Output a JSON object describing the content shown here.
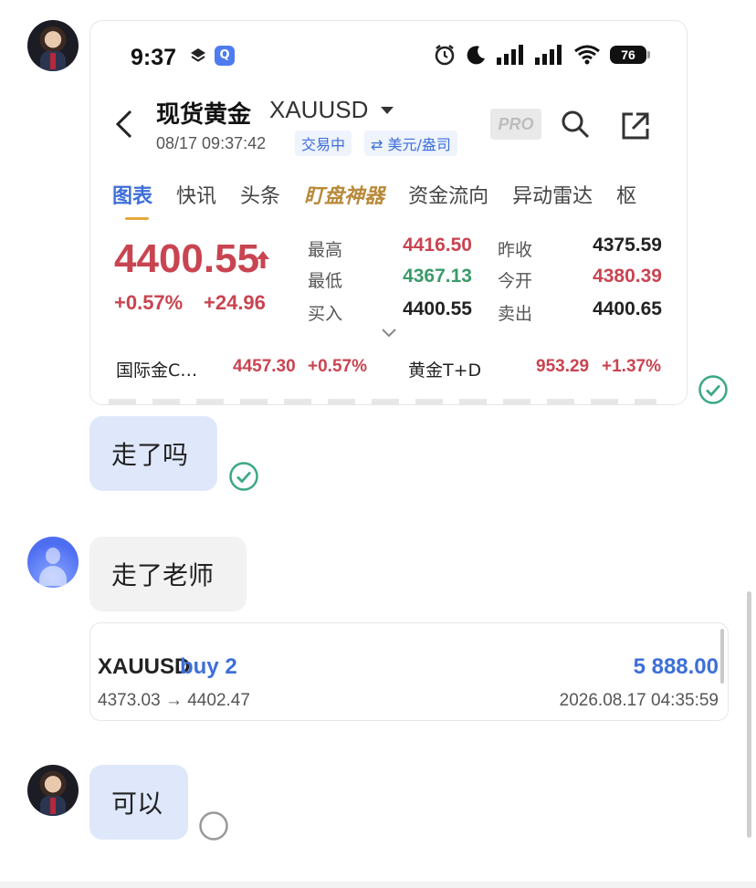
{
  "shared_screenshot": {
    "status_bar": {
      "time": "9:37",
      "battery": "76"
    },
    "header": {
      "title": "现货黄金",
      "symbol": "XAUUSD",
      "datetime": "08/17 09:37:42",
      "status_tag": "交易中",
      "currency_tag": "⇄ 美元/盎司",
      "pro_label": "PRO"
    },
    "tabs": [
      "图表",
      "快讯",
      "头条",
      "盯盘神器",
      "资金流向",
      "异动雷达",
      "枢"
    ],
    "quote": {
      "price": "4400.55",
      "change_pct": "+0.57%",
      "change_abs": "+24.96",
      "high_label": "最高",
      "high": "4416.50",
      "low_label": "最低",
      "low": "4367.13",
      "bid_label": "买入",
      "bid": "4400.55",
      "prev_close_label": "昨收",
      "prev_close": "4375.59",
      "open_label": "今开",
      "open": "4380.39",
      "ask_label": "卖出",
      "ask": "4400.65"
    },
    "reference": {
      "intl_gold_label": "国际金C…",
      "intl_gold_price": "4457.30",
      "intl_gold_pct": "+0.57%",
      "td_label": "黄金T+D",
      "td_price": "953.29",
      "td_pct": "+1.37%"
    }
  },
  "messages": {
    "msg1": "走了吗",
    "msg2": "走了老师",
    "msg3": "可以"
  },
  "trade": {
    "symbol": "XAUUSD",
    "side": "buy 2",
    "profit": "5 888.00",
    "prices": "4373.03 → 4402.47",
    "time": "2026.08.17 04:35:59"
  },
  "colors": {
    "up_red": "#c94451",
    "down_green": "#3b9a6a",
    "accent_blue": "#3e6fd8",
    "bubble_blue": "#dfe8fb",
    "bubble_gray": "#f2f2f2",
    "read_check": "#3ba884"
  }
}
